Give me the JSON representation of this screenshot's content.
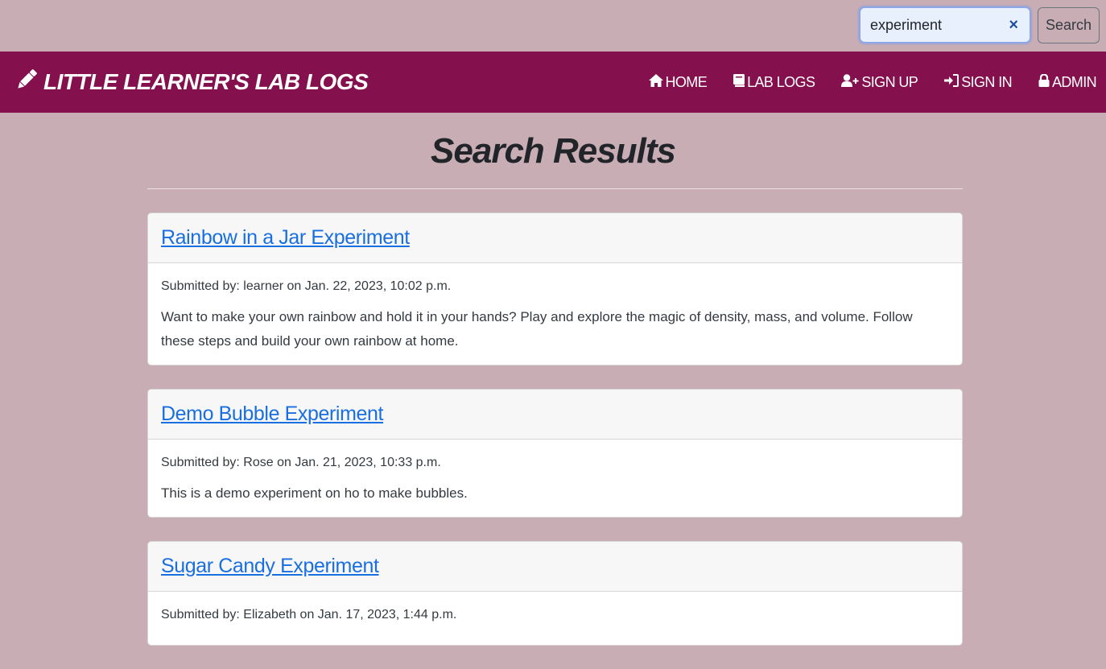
{
  "search": {
    "value": "experiment",
    "clear_symbol": "×",
    "button_label": "Search"
  },
  "navbar": {
    "brand": "LITTLE LEARNER'S LAB LOGS",
    "brand_icon": "pencil-icon",
    "links": [
      {
        "label": "HOME",
        "icon": "home-icon"
      },
      {
        "label": "LAB LOGS",
        "icon": "book-icon"
      },
      {
        "label": "SIGN UP",
        "icon": "user-plus-icon"
      },
      {
        "label": "SIGN IN",
        "icon": "sign-in-icon"
      },
      {
        "label": "ADMIN",
        "icon": "lock-icon"
      }
    ]
  },
  "main": {
    "title": "Search Results",
    "results": [
      {
        "title": "Rainbow in a Jar Experiment",
        "meta": "Submitted by: learner on Jan. 22, 2023, 10:02 p.m.",
        "excerpt": "Want to make your own rainbow and hold it in your hands? Play and explore the magic of density, mass, and volume. Follow these steps and build your own rainbow at home."
      },
      {
        "title": "Demo Bubble Experiment",
        "meta": "Submitted by: Rose on Jan. 21, 2023, 10:33 p.m.",
        "excerpt": "This is a demo experiment on ho to make bubbles."
      },
      {
        "title": "Sugar Candy Experiment",
        "meta": "Submitted by: Elizabeth on Jan. 17, 2023, 1:44 p.m.",
        "excerpt": ""
      }
    ]
  },
  "colors": {
    "page_background": "#c9adb5",
    "navbar": "#84104d",
    "link": "#1a6fe0"
  }
}
